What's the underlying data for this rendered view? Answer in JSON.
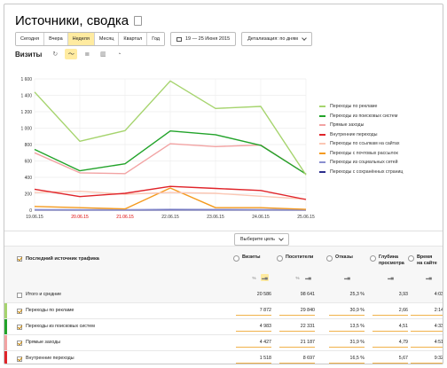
{
  "header": {
    "title": "Источники, сводка"
  },
  "toolbar": {
    "periods": [
      "Сегодня",
      "Вчера",
      "Неделя",
      "Месяц",
      "Квартал",
      "Год"
    ],
    "active_period": "Неделя",
    "date_range": "19 — 25 Июня 2015",
    "detail": "Детализация: по дням"
  },
  "metric": {
    "label": "Визиты"
  },
  "chart_data": {
    "type": "line",
    "x": [
      "19.06.15",
      "20.06.15",
      "21.06.15",
      "22.06.15",
      "23.06.15",
      "24.06.15",
      "25.06.15"
    ],
    "weekend_dates": [
      "20.06.15",
      "21.06.15"
    ],
    "ylim": [
      0,
      1600
    ],
    "yticks": [
      0,
      200,
      400,
      600,
      800,
      1000,
      1200,
      1400,
      1600
    ],
    "ytick_labels": [
      "0",
      "200",
      "400",
      "600",
      "800",
      "1 000",
      "1 200",
      "1 400",
      "1 600"
    ],
    "series": [
      {
        "name": "Переходы по рекламе",
        "color": "#a6d46e",
        "values": [
          1440,
          840,
          970,
          1575,
          1240,
          1265,
          430
        ]
      },
      {
        "name": "Переходы из поисковых систем",
        "color": "#22a32a",
        "values": [
          740,
          480,
          565,
          965,
          920,
          790,
          440
        ]
      },
      {
        "name": "Прямые заходы",
        "color": "#f2a3a3",
        "values": [
          700,
          455,
          445,
          810,
          775,
          795,
          440
        ]
      },
      {
        "name": "Внутренние переходы",
        "color": "#e0242a",
        "values": [
          255,
          165,
          205,
          290,
          265,
          240,
          130
        ]
      },
      {
        "name": "Переходы по ссылкам на сайтах",
        "color": "#fbc7b4",
        "values": [
          215,
          230,
          195,
          215,
          205,
          170,
          135
        ]
      },
      {
        "name": "Переходы с почтовых рассылок",
        "color": "#f49a1e",
        "values": [
          45,
          30,
          15,
          270,
          30,
          30,
          10
        ]
      },
      {
        "name": "Переходы из социальных сетей",
        "color": "#8a8fcf",
        "values": [
          8,
          6,
          7,
          10,
          9,
          8,
          6
        ]
      },
      {
        "name": "Переходы с сохранённых страниц",
        "color": "#2b2d8c",
        "values": [
          3,
          2,
          2,
          3,
          3,
          3,
          2
        ]
      }
    ]
  },
  "goal": {
    "label": "Выберите цель"
  },
  "table": {
    "source_header": "Последний источник трафика",
    "columns": [
      {
        "label": "Визиты",
        "label2": "",
        "sort1": "%",
        "sort2": "▂▄"
      },
      {
        "label": "Посетители",
        "label2": "",
        "sort1": "%",
        "sort2": "▂▄"
      },
      {
        "label": "Отказы",
        "label2": "",
        "sort1": "",
        "sort2": "▂▄"
      },
      {
        "label": "Глубина",
        "label2": "просмотра",
        "sort1": "",
        "sort2": "▂▄"
      },
      {
        "label": "Время",
        "label2": "на сайте",
        "sort1": "",
        "sort2": "▂▄"
      }
    ],
    "totals": {
      "name": "Итого и средние",
      "values": [
        "20 586",
        "98 641",
        "25,3 %",
        "3,93",
        "4:03"
      ]
    },
    "rows": [
      {
        "name": "Переходы по рекламе",
        "color": "#a6d46e",
        "values": [
          "7 872",
          "29 840",
          "30,9 %",
          "2,66",
          "2:14"
        ]
      },
      {
        "name": "Переходы из поисковых систем",
        "color": "#22a32a",
        "values": [
          "4 983",
          "22 331",
          "13,5 %",
          "4,51",
          "4:33"
        ]
      },
      {
        "name": "Прямые заходы",
        "color": "#f2a3a3",
        "values": [
          "4 427",
          "21 187",
          "31,9 %",
          "4,79",
          "4:51"
        ]
      },
      {
        "name": "Внутренние переходы",
        "color": "#e0242a",
        "values": [
          "1 518",
          "8 697",
          "16,5 %",
          "5,67",
          "9:32"
        ]
      }
    ]
  }
}
